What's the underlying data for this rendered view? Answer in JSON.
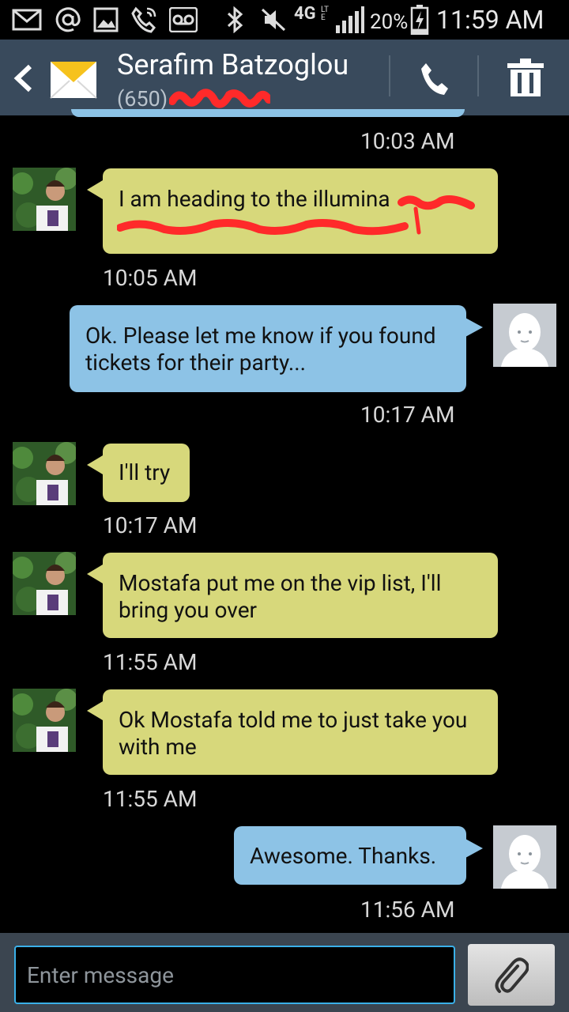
{
  "status_bar": {
    "network": "4G",
    "network_sub": "LTE",
    "battery_percent": "20%",
    "battery_level": 0.2,
    "time": "11:59 AM",
    "left_icons": [
      "email-icon",
      "at-icon",
      "image-icon",
      "missed-call-icon",
      "voicemail-icon"
    ],
    "right_icons": [
      "bluetooth-icon",
      "mute-icon",
      "signal-icon",
      "battery-charging-icon"
    ]
  },
  "header": {
    "contact_name": "Serafim Batzoglou",
    "contact_number": "(650)",
    "icons": [
      "back-icon",
      "envelope-icon",
      "phone-icon",
      "trash-icon"
    ]
  },
  "conversation": {
    "timestamps": [
      "10:03 AM",
      "10:05 AM",
      "10:17 AM",
      "10:17 AM",
      "11:55 AM",
      "11:55 AM",
      "11:56 AM"
    ],
    "messages": [
      {
        "direction": "in",
        "text": "I am heading to the illumina"
      },
      {
        "direction": "out",
        "text": "Ok. Please let me know if you found tickets for their party..."
      },
      {
        "direction": "in",
        "text": "I'll try"
      },
      {
        "direction": "in",
        "text": "Mostafa put me on the vip list, I'll bring you over"
      },
      {
        "direction": "in",
        "text": "Ok Mostafa told me to just take you with me"
      },
      {
        "direction": "out",
        "text": "Awesome. Thanks."
      }
    ]
  },
  "composer": {
    "placeholder": "Enter message",
    "icons": [
      "attach-icon"
    ]
  },
  "colors": {
    "header_bg": "#394a5c",
    "incoming_bubble": "#d7d87b",
    "outgoing_bubble": "#8dc3e6",
    "input_border": "#3ab0e8",
    "redaction": "#ff2a2a"
  }
}
